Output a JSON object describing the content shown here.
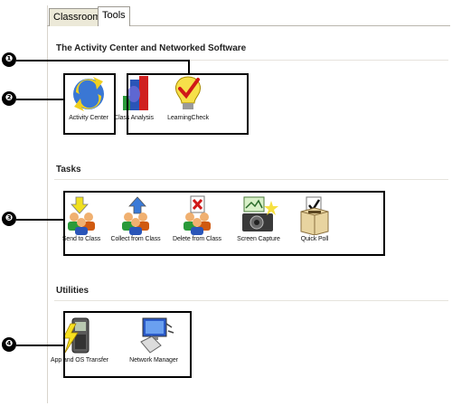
{
  "tabs": [
    {
      "label": "Classroom",
      "active": false
    },
    {
      "label": "Tools",
      "active": true
    }
  ],
  "sections": {
    "activity": {
      "title": "The Activity Center and Networked Software",
      "items": [
        {
          "label": "Activity Center",
          "icon": "activity-center-icon"
        },
        {
          "label": "Class Analysis",
          "icon": "class-analysis-icon"
        },
        {
          "label": "LearningCheck",
          "icon": "learningcheck-icon"
        }
      ]
    },
    "tasks": {
      "title": "Tasks",
      "items": [
        {
          "label": "Send to Class",
          "icon": "send-to-class-icon"
        },
        {
          "label": "Collect from Class",
          "icon": "collect-from-class-icon"
        },
        {
          "label": "Delete from Class",
          "icon": "delete-from-class-icon"
        },
        {
          "label": "Screen Capture",
          "icon": "screen-capture-icon"
        },
        {
          "label": "Quick Poll",
          "icon": "quick-poll-icon"
        }
      ]
    },
    "utilities": {
      "title": "Utilities",
      "items": [
        {
          "label": "App and OS Transfer",
          "icon": "app-os-transfer-icon"
        },
        {
          "label": "Network Manager",
          "icon": "network-manager-icon"
        }
      ]
    }
  },
  "callouts": [
    "❶",
    "❷",
    "❸",
    "❹"
  ]
}
